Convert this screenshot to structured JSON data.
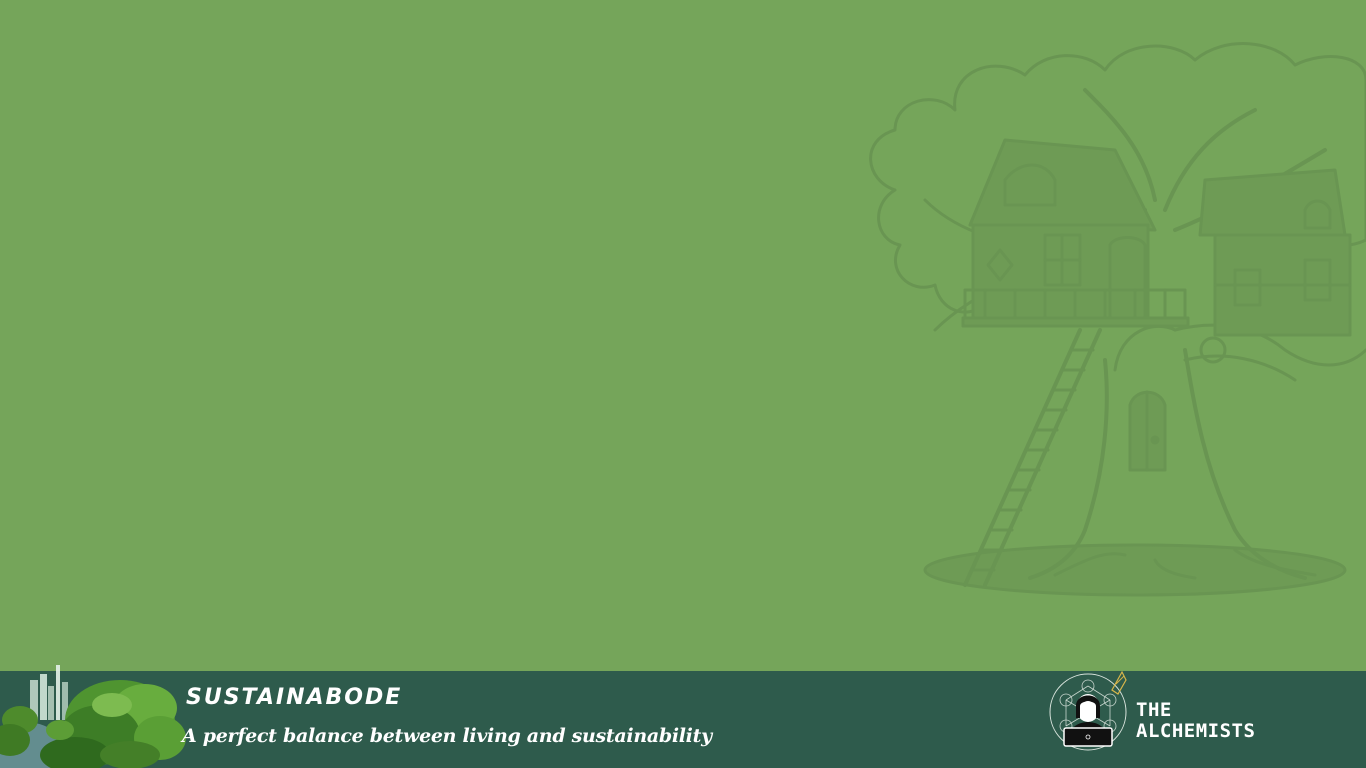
{
  "slide": {
    "background_color": "#75a55a",
    "illustration": "treehouse-illustration",
    "illustration_color": "#699552"
  },
  "footer": {
    "background_color": "#2e5b4c",
    "brand_title": "SUSTAINABODE",
    "brand_tagline": "A perfect balance between living and sustainability",
    "team_logo": "alchemists-logo",
    "team_name_line1": "THE",
    "team_name_line2": "ALCHEMISTS"
  }
}
